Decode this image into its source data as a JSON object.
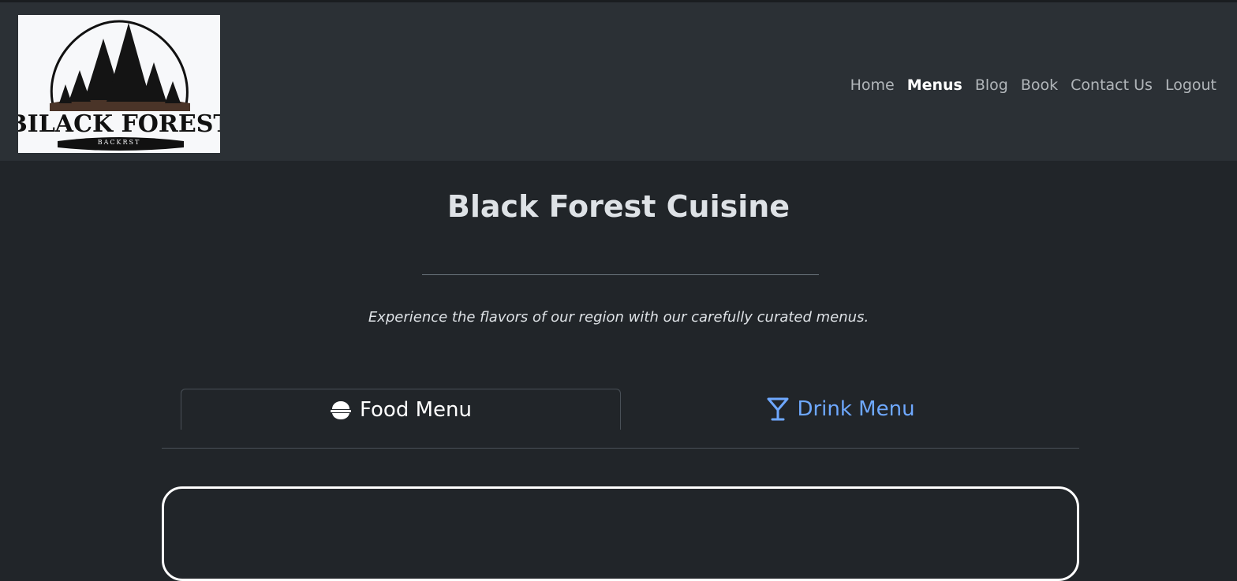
{
  "header": {
    "logo": {
      "text": "BILACK FOREST",
      "subtext": "BACKRST"
    },
    "nav": [
      {
        "label": "Home",
        "active": false
      },
      {
        "label": "Menus",
        "active": true
      },
      {
        "label": "Blog",
        "active": false
      },
      {
        "label": "Book",
        "active": false
      },
      {
        "label": "Contact Us",
        "active": false
      },
      {
        "label": "Logout",
        "active": false
      }
    ]
  },
  "main": {
    "title": "Black Forest Cuisine",
    "subtitle": "Experience the flavors of our region with our carefully curated menus.",
    "tabs": [
      {
        "label": "Food Menu",
        "icon": "bowl-food-icon",
        "active": true
      },
      {
        "label": "Drink Menu",
        "icon": "martini-glass-icon",
        "active": false
      }
    ]
  },
  "colors": {
    "page_bg": "#212529",
    "header_bg": "#2b3035",
    "link_accent": "#6ea8fe",
    "text": "#dee2e6"
  }
}
